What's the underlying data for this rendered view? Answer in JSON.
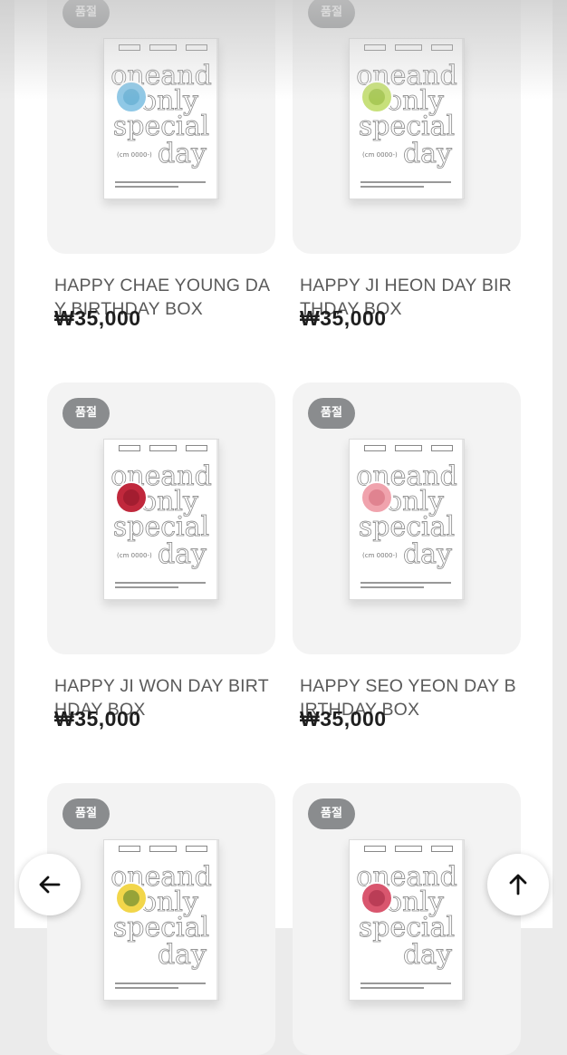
{
  "products": [
    {
      "badge": "품절",
      "name": "HAPPY CHAE YOUNG DAY BIRTHDAY BOX",
      "price": "₩35,000",
      "cover": {
        "line1": "oneand",
        "line2": "only",
        "line3": "special",
        "line4": "day",
        "code": "(cm 0000-)"
      },
      "accent": "#8fc8e6",
      "accent_dark": "#5aa8cc"
    },
    {
      "badge": "품절",
      "name": "HAPPY JI HEON DAY BIRTHDAY BOX",
      "price": "₩35,000",
      "cover": {
        "line1": "oneand",
        "line2": "only",
        "line3": "special",
        "line4": "day",
        "code": "(cm 0000-)"
      },
      "accent": "#c7e07a",
      "accent_dark": "#8fb63a"
    },
    {
      "badge": "품절",
      "name": "HAPPY JI WON DAY BIRTHDAY BOX",
      "price": "₩35,000",
      "cover": {
        "line1": "oneand",
        "line2": "only",
        "line3": "special",
        "line4": "day",
        "code": "(cm 0000-)"
      },
      "accent": "#c0283c",
      "accent_dark": "#8a1426"
    },
    {
      "badge": "품절",
      "name": "HAPPY SEO YEON DAY BIRTHDAY BOX",
      "price": "₩35,000",
      "cover": {
        "line1": "oneand",
        "line2": "only",
        "line3": "special",
        "line4": "day",
        "code": "(cm 0000-)"
      },
      "accent": "#f0a3ad",
      "accent_dark": "#d46a78"
    },
    {
      "badge": "품절",
      "name": "",
      "price": "",
      "cover": {
        "line1": "oneand",
        "line2": "only",
        "line3": "special",
        "line4": "day",
        "code": ""
      },
      "accent": "#f2d64a",
      "accent_dark": "#4b7a2a"
    },
    {
      "badge": "품절",
      "name": "",
      "price": "",
      "cover": {
        "line1": "oneand",
        "line2": "only",
        "line3": "special",
        "line4": "day",
        "code": ""
      },
      "accent": "#d9566e",
      "accent_dark": "#a02a44"
    }
  ],
  "buttons": {
    "back_icon": "arrow-left-icon",
    "top_icon": "arrow-up-icon"
  }
}
